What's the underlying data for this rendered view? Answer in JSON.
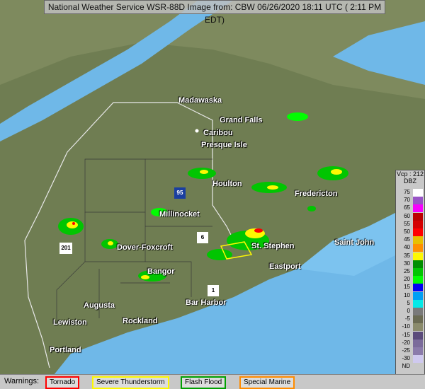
{
  "title": "National Weather Service WSR-88D Image from: CBW 06/26/2020 18:11 UTC ( 2:11 PM EDT)",
  "cities": [
    {
      "name": "Madawaska",
      "key": "madawaska"
    },
    {
      "name": "Grand Falls",
      "key": "grand_falls"
    },
    {
      "name": "Caribou",
      "key": "caribou"
    },
    {
      "name": "Presque Isle",
      "key": "presque_isle"
    },
    {
      "name": "Houlton",
      "key": "houlton"
    },
    {
      "name": "Fredericton",
      "key": "fredericton"
    },
    {
      "name": "Millinocket",
      "key": "millinocket"
    },
    {
      "name": "Dover-Foxcroft",
      "key": "dover_foxcroft"
    },
    {
      "name": "St. Stephen",
      "key": "st_stephen"
    },
    {
      "name": "Saint John",
      "key": "saint_john"
    },
    {
      "name": "Eastport",
      "key": "eastport"
    },
    {
      "name": "Bangor",
      "key": "bangor"
    },
    {
      "name": "Augusta",
      "key": "augusta"
    },
    {
      "name": "Bar Harbor",
      "key": "bar_harbor"
    },
    {
      "name": "Rockland",
      "key": "rockland"
    },
    {
      "name": "Lewiston",
      "key": "lewiston"
    },
    {
      "name": "Portland",
      "key": "portland"
    }
  ],
  "highways": [
    "95",
    "6",
    "1",
    "201"
  ],
  "legend": {
    "header": "Vcp : 212",
    "unit": "DBZ",
    "levels": [
      {
        "label": "75",
        "color": "#ffffff"
      },
      {
        "label": "70",
        "color": "#9854c6"
      },
      {
        "label": "65",
        "color": "#f800fd"
      },
      {
        "label": "60",
        "color": "#bc0000"
      },
      {
        "label": "55",
        "color": "#d40000"
      },
      {
        "label": "50",
        "color": "#ff0000"
      },
      {
        "label": "45",
        "color": "#e7c000"
      },
      {
        "label": "40",
        "color": "#ff9000"
      },
      {
        "label": "35",
        "color": "#fdf802"
      },
      {
        "label": "30",
        "color": "#008e00"
      },
      {
        "label": "25",
        "color": "#01c501"
      },
      {
        "label": "20",
        "color": "#02fd02"
      },
      {
        "label": "15",
        "color": "#0300f4"
      },
      {
        "label": "10",
        "color": "#019ff4"
      },
      {
        "label": "5",
        "color": "#04e9e7"
      },
      {
        "label": "0",
        "color": "#7a7a7a"
      },
      {
        "label": "-5",
        "color": "#6b6b53"
      },
      {
        "label": "-10",
        "color": "#8b8b6c"
      },
      {
        "label": "-15",
        "color": "#5b4b7b"
      },
      {
        "label": "-20",
        "color": "#7b6b9b"
      },
      {
        "label": "-25",
        "color": "#8b7bab"
      },
      {
        "label": "-30",
        "color": "#cfc9ef"
      },
      {
        "label": "ND",
        "color": "#c8c8c8"
      }
    ]
  },
  "warnings": {
    "label": "Warnings:",
    "items": [
      {
        "name": "Tornado",
        "color": "#ff0000"
      },
      {
        "name": "Severe Thunderstorm",
        "color": "#ffa500"
      },
      {
        "name": "Flash Flood",
        "color": "#00a000"
      },
      {
        "name": "Special Marine",
        "color": "#ff8c00"
      }
    ]
  }
}
